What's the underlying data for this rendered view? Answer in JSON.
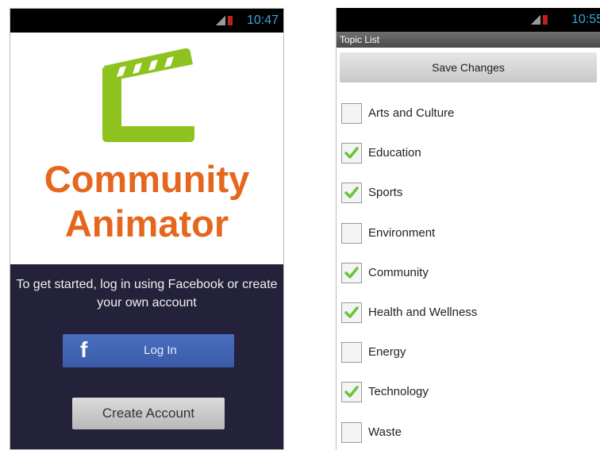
{
  "left_screen": {
    "status_time": "10:47",
    "title_line1": "Community",
    "title_line2": "Animator",
    "intro_text": "To get started, log in using Facebook or create your own account",
    "facebook_button_label": "Log In",
    "facebook_glyph": "f",
    "create_account_label": "Create Account"
  },
  "right_screen": {
    "status_time": "10:55",
    "title": "Topic List",
    "save_button_label": "Save Changes",
    "topics": [
      {
        "label": "Arts and Culture",
        "checked": false
      },
      {
        "label": "Education",
        "checked": true
      },
      {
        "label": "Sports",
        "checked": true
      },
      {
        "label": "Environment",
        "checked": false
      },
      {
        "label": "Community",
        "checked": true
      },
      {
        "label": "Health and Wellness",
        "checked": true
      },
      {
        "label": "Energy",
        "checked": false
      },
      {
        "label": "Technology",
        "checked": true
      },
      {
        "label": "Waste",
        "checked": false
      }
    ]
  },
  "colors": {
    "brand_orange": "#e5661d",
    "logo_green": "#8dc21f",
    "check_green": "#6cc23c",
    "facebook_blue": "#3b5998",
    "dark_background": "#24223a"
  }
}
